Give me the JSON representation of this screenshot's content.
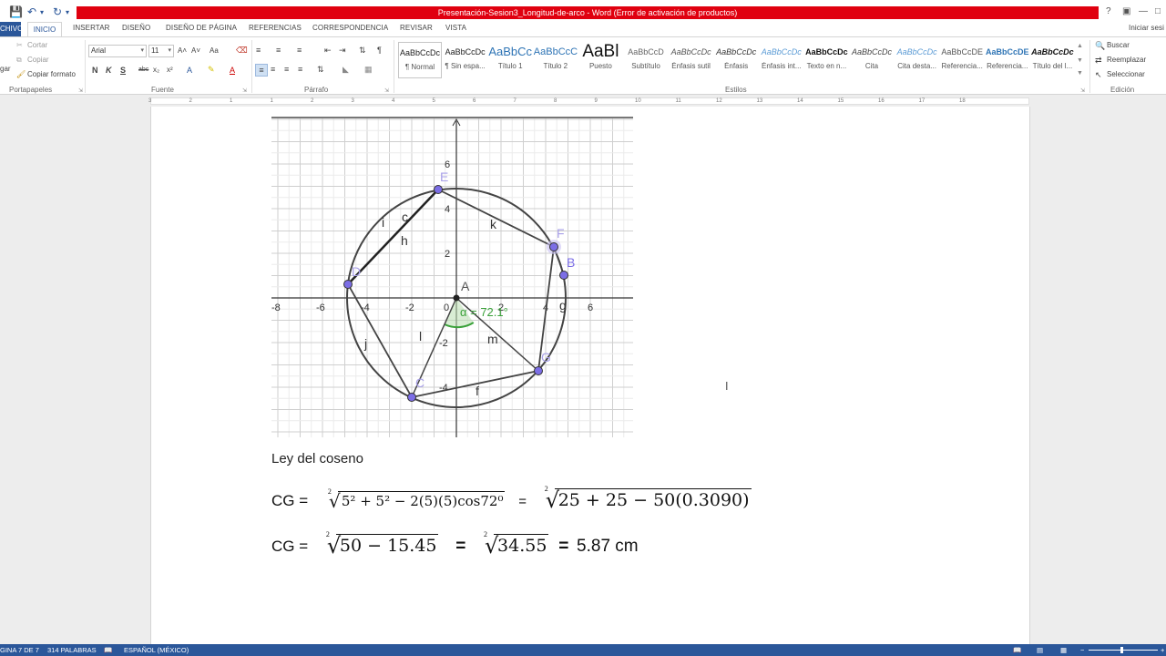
{
  "title_bar": {
    "document_title": "Presentación-Sesion3_Longitud-de-arco - Word (Error de activación de productos)",
    "help": "?",
    "sign_in": "Iniciar sesi"
  },
  "tabs": [
    "CHIVO",
    "INICIO",
    "INSERTAR",
    "DISEÑO",
    "DISEÑO DE PÁGINA",
    "REFERENCIAS",
    "CORRESPONDENCIA",
    "REVISAR",
    "VISTA"
  ],
  "clipboard": {
    "cut": "Cortar",
    "copy": "Copiar",
    "format_painter": "Copiar formato",
    "paste_partial": "gar",
    "group_label": "Portapapeles"
  },
  "font": {
    "family": "Arial",
    "size": "11",
    "group_label": "Fuente",
    "bold": "N",
    "italic": "K",
    "underline": "S",
    "strike": "abc",
    "subscript": "x₂",
    "superscript": "x²",
    "grow": "A˄",
    "shrink": "A˅",
    "case": "Aa",
    "highlight": "A",
    "font_color": "A"
  },
  "paragraph": {
    "group_label": "Párrafo"
  },
  "styles": {
    "group_label": "Estilos",
    "items": [
      {
        "preview": "AaBbCcDc",
        "name": "¶ Normal"
      },
      {
        "preview": "AaBbCcDc",
        "name": "¶ Sin espa..."
      },
      {
        "preview": "AaBbCc",
        "name": "Título 1"
      },
      {
        "preview": "AaBbCcC",
        "name": "Título 2"
      },
      {
        "preview": "AaBl",
        "name": "Puesto"
      },
      {
        "preview": "AaBbCcD",
        "name": "Subtítulo"
      },
      {
        "preview": "AaBbCcDc",
        "name": "Énfasis sutil"
      },
      {
        "preview": "AaBbCcDc",
        "name": "Énfasis"
      },
      {
        "preview": "AaBbCcDc",
        "name": "Énfasis int..."
      },
      {
        "preview": "AaBbCcDc",
        "name": "Texto en n..."
      },
      {
        "preview": "AaBbCcDc",
        "name": "Cita"
      },
      {
        "preview": "AaBbCcDc",
        "name": "Cita desta..."
      },
      {
        "preview": "AaBbCcDE",
        "name": "Referencia..."
      },
      {
        "preview": "AaBbCcDE",
        "name": "Referencia..."
      },
      {
        "preview": "AaBbCcDc",
        "name": "Título del l..."
      }
    ]
  },
  "editing": {
    "find": "Buscar",
    "replace": "Reemplazar",
    "select": "Seleccionar",
    "group_label": "Edición"
  },
  "ruler_numbers": [
    "3",
    "2",
    "1",
    "1",
    "2",
    "3",
    "4",
    "5",
    "6",
    "7",
    "8",
    "9",
    "10",
    "11",
    "12",
    "13",
    "14",
    "15",
    "16",
    "17",
    "18"
  ],
  "figure": {
    "tick_labels_x": [
      "-8",
      "-6",
      "-4",
      "-2",
      "0",
      "2",
      "4",
      "6"
    ],
    "tick_labels_y": [
      "6",
      "4",
      "2",
      "-2",
      "-4"
    ],
    "points": [
      "A",
      "B",
      "C",
      "D",
      "E",
      "F",
      "G"
    ],
    "segments": [
      "c",
      "h",
      "i",
      "k",
      "j",
      "l",
      "m",
      "f",
      "g"
    ],
    "angle_label": "α = 72.1°"
  },
  "document": {
    "heading": "Ley del coseno",
    "eq1_lhs": "CG =",
    "eq1_idx": "2",
    "eq1_radicand": "5² + 5² − 2(5)(5)cos72⁰",
    "eq1_eq": "=",
    "eq1_idx2": "2",
    "eq1_radicand2": "25 + 25  −  50(0.3090)",
    "eq2_lhs": "CG =",
    "eq2_idx": "2",
    "eq2_radicand": "50  −  15.45",
    "eq2_eq": "=",
    "eq2_idx2": "2",
    "eq2_radicand2": "34.55",
    "eq2_eq2": "=",
    "eq2_result": "5.87 cm"
  },
  "status_bar": {
    "page": "GINA 7 DE 7",
    "words": "314 PALABRAS",
    "language": "ESPAÑOL (MÉXICO)"
  },
  "colors": {
    "accent": "#2b579a",
    "title_red": "#e0000f",
    "point_fill": "#7c6ee6",
    "angle_green": "#3aa13a"
  }
}
